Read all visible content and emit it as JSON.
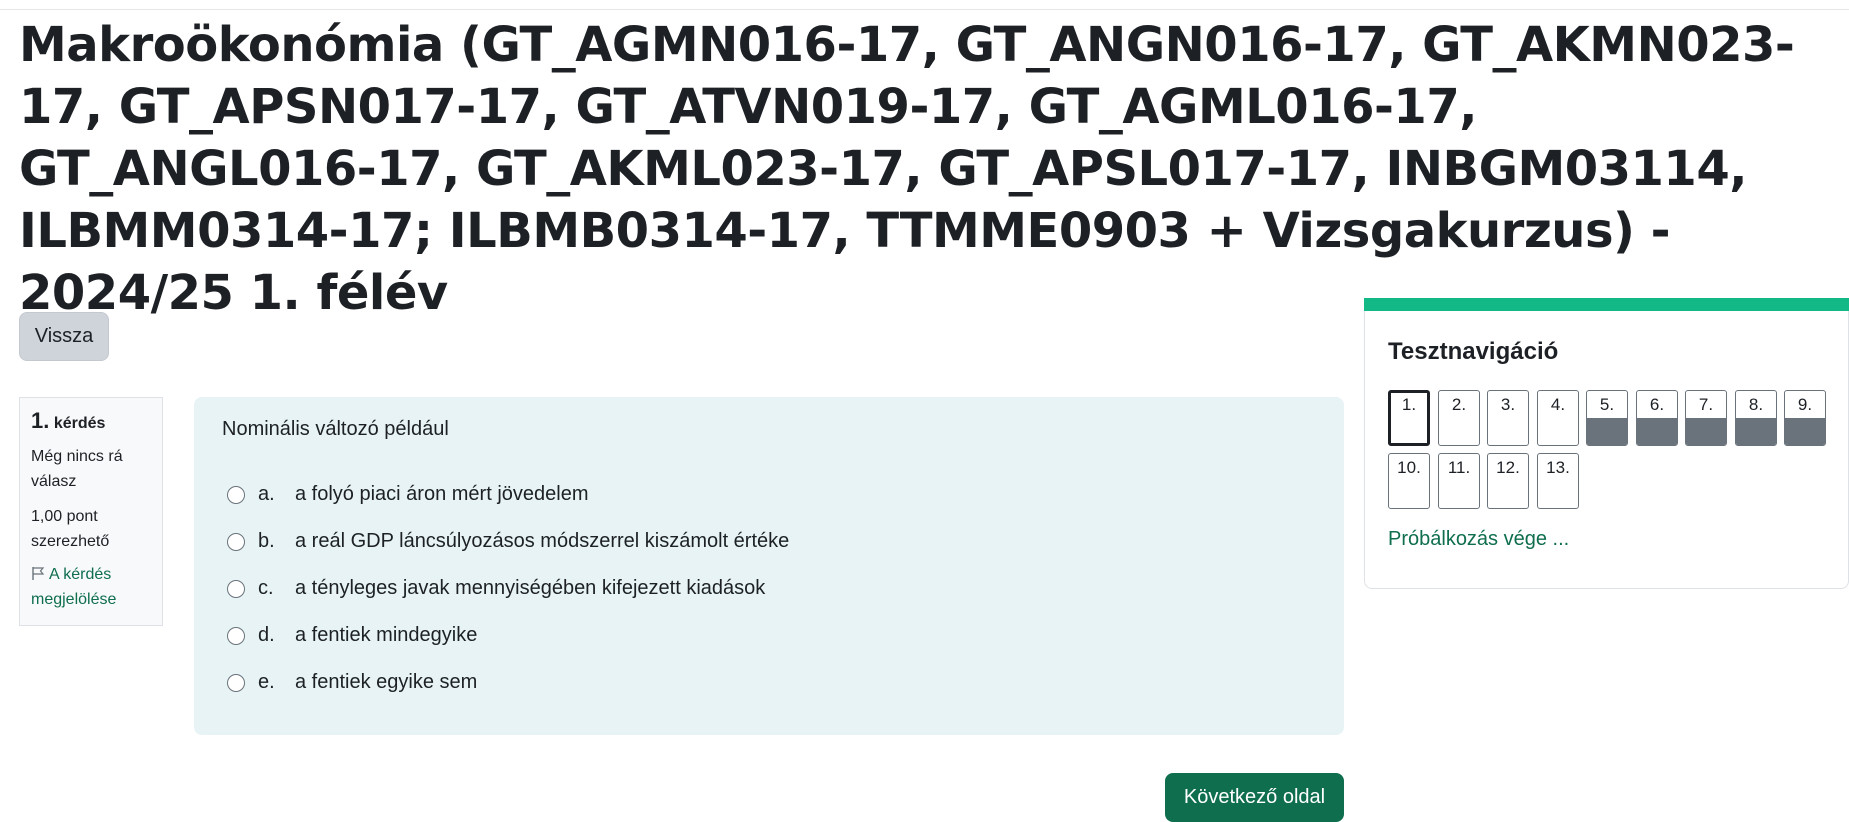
{
  "page": {
    "title": "Makroökonómia (GT_AGMN016-17, GT_ANGN016-17, GT_AKMN023-17, GT_APSN017-17, GT_ATVN019-17, GT_AGML016-17, GT_ANGL016-17, GT_AKML023-17, GT_APSL017-17, INBGM03114, ILBMM0314-17; ILBMB0314-17, TTMME0903 + Vizsgakurzus) - 2024/25 1. félév"
  },
  "back_button": "Vissza",
  "question": {
    "number": "1.",
    "label": "kérdés",
    "state": "Még nincs rá válasz",
    "grade": "1,00 pont szerezhető",
    "flag_label": "A kérdés megjelölése",
    "text": "Nominális változó például",
    "answers": [
      {
        "letter": "a.",
        "text": "a folyó piaci áron mért jövedelem"
      },
      {
        "letter": "b.",
        "text": "a reál GDP láncsúlyozásos módszerrel kiszámolt értéke"
      },
      {
        "letter": "c.",
        "text": "a tényleges javak mennyiségében kifejezett kiadások"
      },
      {
        "letter": "d.",
        "text": "a fentiek mindegyike"
      },
      {
        "letter": "e.",
        "text": "a fentiek egyike sem"
      }
    ]
  },
  "next_button": "Következő oldal",
  "navigation": {
    "title": "Tesztnavigáció",
    "buttons": [
      {
        "label": "1.",
        "current": true,
        "answered": false
      },
      {
        "label": "2.",
        "current": false,
        "answered": false
      },
      {
        "label": "3.",
        "current": false,
        "answered": false
      },
      {
        "label": "4.",
        "current": false,
        "answered": false
      },
      {
        "label": "5.",
        "current": false,
        "answered": true
      },
      {
        "label": "6.",
        "current": false,
        "answered": true
      },
      {
        "label": "7.",
        "current": false,
        "answered": true
      },
      {
        "label": "8.",
        "current": false,
        "answered": true
      },
      {
        "label": "9.",
        "current": false,
        "answered": true
      },
      {
        "label": "10.",
        "current": false,
        "answered": false
      },
      {
        "label": "11.",
        "current": false,
        "answered": false
      },
      {
        "label": "12.",
        "current": false,
        "answered": false
      },
      {
        "label": "13.",
        "current": false,
        "answered": false
      }
    ],
    "end_link": "Próbálkozás vége ..."
  },
  "colors": {
    "accent": "#12b886",
    "primary_button": "#0f6e4e",
    "question_bg": "#e7f3f5",
    "answered_fill": "#6a737b"
  }
}
